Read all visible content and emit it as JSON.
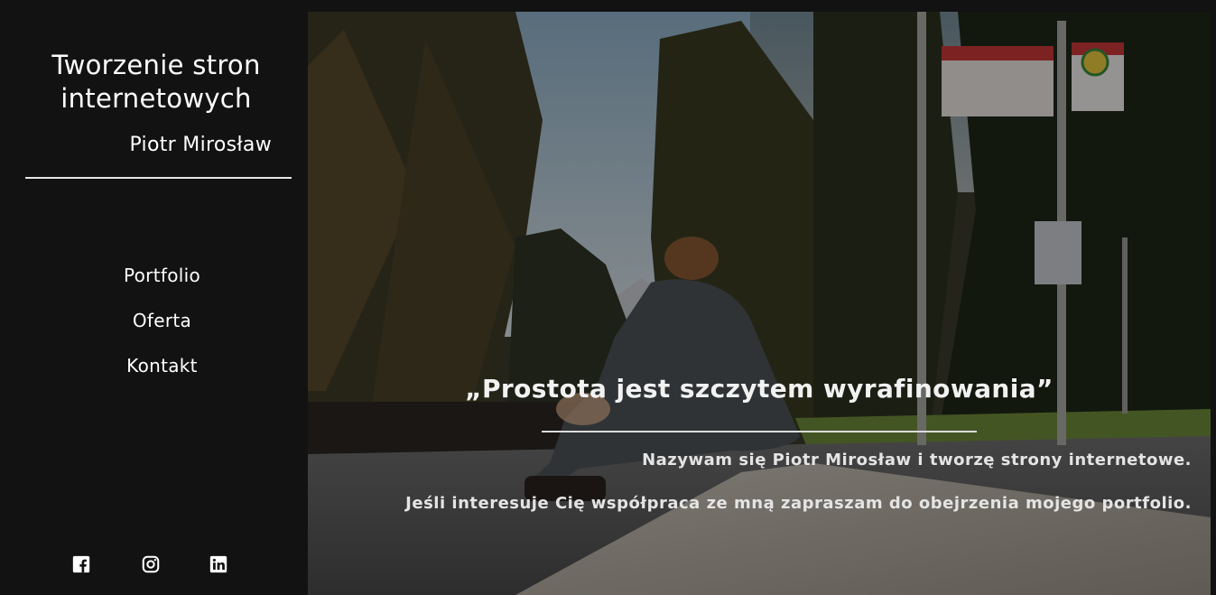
{
  "brand": {
    "title": "Tworzenie stron internetowych",
    "name": "Piotr Mirosław"
  },
  "nav": {
    "items": [
      {
        "label": "Portfolio"
      },
      {
        "label": "Oferta"
      },
      {
        "label": "Kontakt"
      }
    ]
  },
  "social": {
    "icons": [
      "facebook-icon",
      "instagram-icon",
      "linkedin-icon"
    ]
  },
  "hero": {
    "quote": "„Prostota jest szczytem wyrafinowania”",
    "intro_line_1": "Nazywam się Piotr Mirosław i tworzę strony internetowe.",
    "intro_line_2": "Jeśli interesuje Cię współpraca ze mną zapraszam do obejrzenia mojego portfolio."
  },
  "colors": {
    "background": "#121212",
    "text": "#ffffff",
    "divider": "#e6e6e6"
  }
}
